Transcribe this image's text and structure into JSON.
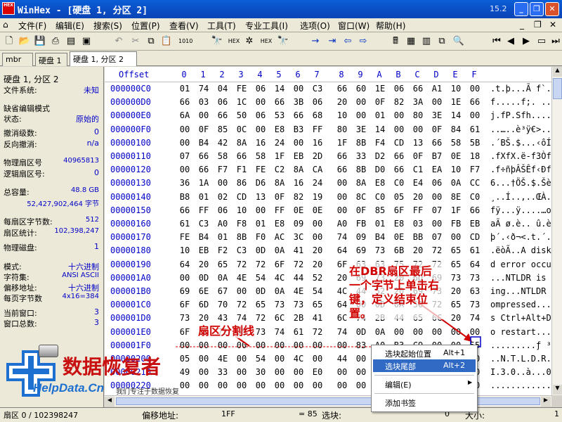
{
  "window": {
    "title": "WinHex - [硬盘 1, 分区 2]",
    "version": "15.2",
    "logo_text": "HEX"
  },
  "menu": [
    "文件(F)",
    "编辑(E)",
    "搜索(S)",
    "位置(P)",
    "查看(V)",
    "工具(T)",
    "专业工具(I)",
    "选项(O)",
    "窗口(W)",
    "帮助(H)"
  ],
  "tabs": [
    "mbr",
    "硬盘 1",
    "硬盘 1, 分区 2"
  ],
  "info": {
    "disk_name": "硬盘 1, 分区 2",
    "fs_label": "文件系统:",
    "fs_value": "未知",
    "mode_title": "缺省编辑模式",
    "state_label": "状态:",
    "state_value": "原始的",
    "undo_label": "撤消级数:",
    "undo_value": "0",
    "reverse_label": "反向撤消:",
    "reverse_value": "n/a",
    "phys_sector_label": "物理扇区号",
    "phys_sector_value": "40965813",
    "logic_sector_label": "逻辑扇区号:",
    "logic_sector_value": "0",
    "capacity_label": "总容量:",
    "capacity_gb": "48.8 GB",
    "capacity_bytes": "52,427,902,464 字节",
    "bps_label": "每扇区字节数:",
    "bps_value": "512",
    "sector_count_label": "扇区统计:",
    "sector_count_value": "102,398,247",
    "phys_disk_label": "物理磁盘:",
    "phys_disk_value": "1",
    "mode_label": "模式:",
    "mode_value": "十六进制",
    "charset_label": "字符集:",
    "charset_value": "ANSI ASCII",
    "offset_label": "偏移地址:",
    "offset_value": "十六进制",
    "bpp_label": "每页字节数",
    "bpp_value": "4x16=384",
    "cur_window_label": "当前窗口:",
    "cur_window_value": "3",
    "window_total_label": "窗口总数:",
    "window_total_value": "3"
  },
  "hex": {
    "header_offset": "Offset",
    "columns": [
      "0",
      "1",
      "2",
      "3",
      "4",
      "5",
      "6",
      "7",
      "8",
      "9",
      "A",
      "B",
      "C",
      "D",
      "E",
      "F"
    ],
    "rows": [
      {
        "off": "000000C0",
        "bytes": [
          "01",
          "74",
          "04",
          "FE",
          "06",
          "14",
          "00",
          "C3",
          "66",
          "60",
          "1E",
          "06",
          "66",
          "A1",
          "10",
          "00"
        ],
        "ascii": ".t.þ...Ã f`..f¡.."
      },
      {
        "off": "000000D0",
        "bytes": [
          "66",
          "03",
          "06",
          "1C",
          "00",
          "66",
          "3B",
          "06",
          "20",
          "00",
          "0F",
          "82",
          "3A",
          "00",
          "1E",
          "66"
        ],
        "ascii": "f.....f;. ..‚:..f"
      },
      {
        "off": "000000E0",
        "bytes": [
          "6A",
          "00",
          "66",
          "50",
          "06",
          "53",
          "66",
          "68",
          "10",
          "00",
          "01",
          "00",
          "80",
          "3E",
          "14",
          "00"
        ],
        "ascii": "j.fP.Sfh.....>.."
      },
      {
        "off": "000000F0",
        "bytes": [
          "00",
          "0F",
          "85",
          "0C",
          "00",
          "E8",
          "B3",
          "FF",
          "80",
          "3E",
          "14",
          "00",
          "00",
          "0F",
          "84",
          "61"
        ],
        "ascii": "..…..è³ÿ€>....„a"
      },
      {
        "off": "00000100",
        "bytes": [
          "00",
          "B4",
          "42",
          "8A",
          "16",
          "24",
          "00",
          "16",
          "1F",
          "8B",
          "F4",
          "CD",
          "13",
          "66",
          "58",
          "5B"
        ],
        "ascii": ".´BŠ.$...‹ôÍ.fX["
      },
      {
        "off": "00000110",
        "bytes": [
          "07",
          "66",
          "58",
          "66",
          "58",
          "1F",
          "EB",
          "2D",
          "66",
          "33",
          "D2",
          "66",
          "0F",
          "B7",
          "0E",
          "18"
        ],
        "ascii": ".fXfX.ë-f3Òf.·.."
      },
      {
        "off": "00000120",
        "bytes": [
          "00",
          "66",
          "F7",
          "F1",
          "FE",
          "C2",
          "8A",
          "CA",
          "66",
          "8B",
          "D0",
          "66",
          "C1",
          "EA",
          "10",
          "F7"
        ],
        "ascii": ".f÷ñþÂŠÊf‹ÐfÁê.÷"
      },
      {
        "off": "00000130",
        "bytes": [
          "36",
          "1A",
          "00",
          "86",
          "D6",
          "8A",
          "16",
          "24",
          "00",
          "8A",
          "E8",
          "C0",
          "E4",
          "06",
          "0A",
          "CC"
        ],
        "ascii": "6...†ÖŠ.$.ŠèÀä..Ì"
      },
      {
        "off": "00000140",
        "bytes": [
          "B8",
          "01",
          "02",
          "CD",
          "13",
          "0F",
          "82",
          "19",
          "00",
          "8C",
          "C0",
          "05",
          "20",
          "00",
          "8E",
          "C0"
        ],
        "ascii": "¸..Í..‚..ŒÀ. .ŽÀ"
      },
      {
        "off": "00000150",
        "bytes": [
          "66",
          "FF",
          "06",
          "10",
          "00",
          "FF",
          "0E",
          "0E",
          "00",
          "0F",
          "85",
          "6F",
          "FF",
          "07",
          "1F",
          "66"
        ],
        "ascii": "fÿ...ÿ....…oÿ..f"
      },
      {
        "off": "00000160",
        "bytes": [
          "61",
          "C3",
          "A0",
          "F8",
          "01",
          "E8",
          "09",
          "00",
          "A0",
          "FB",
          "01",
          "E8",
          "03",
          "00",
          "FB",
          "EB"
        ],
        "ascii": "aÃ ø.è.. û.è..ûë"
      },
      {
        "off": "00000170",
        "bytes": [
          "FE",
          "B4",
          "01",
          "8B",
          "F0",
          "AC",
          "3C",
          "00",
          "74",
          "09",
          "B4",
          "0E",
          "BB",
          "07",
          "00",
          "CD"
        ],
        "ascii": "þ´.‹ð¬<.t.´.»..Í"
      },
      {
        "off": "00000180",
        "bytes": [
          "10",
          "EB",
          "F2",
          "C3",
          "0D",
          "0A",
          "41",
          "20",
          "64",
          "69",
          "73",
          "6B",
          "20",
          "72",
          "65",
          "61"
        ],
        "ascii": ".ëòÃ..A disk rea"
      },
      {
        "off": "00000190",
        "bytes": [
          "64",
          "20",
          "65",
          "72",
          "72",
          "6F",
          "72",
          "20",
          "6F",
          "63",
          "63",
          "75",
          "72",
          "72",
          "65",
          "64"
        ],
        "ascii": "d error occurred"
      },
      {
        "off": "000001A0",
        "bytes": [
          "00",
          "0D",
          "0A",
          "4E",
          "54",
          "4C",
          "44",
          "52",
          "20",
          "69",
          "73",
          "20",
          "6D",
          "69",
          "73",
          "73"
        ],
        "ascii": "...NTLDR is miss"
      },
      {
        "off": "000001B0",
        "bytes": [
          "69",
          "6E",
          "67",
          "00",
          "0D",
          "0A",
          "4E",
          "54",
          "4C",
          "44",
          "52",
          "20",
          "69",
          "73",
          "20",
          "63"
        ],
        "ascii": "ing...NTLDR is c"
      },
      {
        "off": "000001C0",
        "bytes": [
          "6F",
          "6D",
          "70",
          "72",
          "65",
          "73",
          "73",
          "65",
          "64",
          "00",
          "0D",
          "0A",
          "50",
          "72",
          "65",
          "73"
        ],
        "ascii": "ompressed...Pres"
      },
      {
        "off": "000001D0",
        "bytes": [
          "73",
          "20",
          "43",
          "74",
          "72",
          "6C",
          "2B",
          "41",
          "6C",
          "74",
          "2B",
          "44",
          "65",
          "6C",
          "20",
          "74"
        ],
        "ascii": "s Ctrl+Alt+Del t"
      },
      {
        "off": "000001E0",
        "bytes": [
          "6F",
          "20",
          "72",
          "65",
          "73",
          "74",
          "61",
          "72",
          "74",
          "0D",
          "0A",
          "00",
          "00",
          "00",
          "00",
          "00"
        ],
        "ascii": "o restart......."
      },
      {
        "off": "000001F0",
        "bytes": [
          "00",
          "00",
          "00",
          "00",
          "00",
          "00",
          "00",
          "00",
          "00",
          "83",
          "A0",
          "B3",
          "C9",
          "00",
          "00",
          "55"
        ],
        "ascii": ".........ƒ ³É..U"
      },
      {
        "off": "00000200",
        "bytes": [
          "05",
          "00",
          "4E",
          "00",
          "54",
          "00",
          "4C",
          "00",
          "44",
          "00",
          "52",
          "00",
          "04",
          "00",
          "24",
          "00"
        ],
        "ascii": "..N.T.L.D.R...$."
      },
      {
        "off": "00000210",
        "bytes": [
          "49",
          "00",
          "33",
          "00",
          "30",
          "00",
          "00",
          "E0",
          "00",
          "00",
          "00",
          "30",
          "00",
          "00",
          "00",
          "00"
        ],
        "ascii": "I.3.0..à...0...."
      },
      {
        "off": "00000220",
        "bytes": [
          "00",
          "00",
          "00",
          "00",
          "00",
          "00",
          "00",
          "00",
          "00",
          "00",
          "00",
          "00",
          "00",
          "00",
          "00",
          "00"
        ],
        "ascii": "................"
      }
    ]
  },
  "annotations": {
    "dbr_note_lines": [
      "在DBR扇区最后",
      "一个字节上单击右",
      "键，定义结束位",
      "置。"
    ],
    "sector_divider": "扇区分割线"
  },
  "context_menu": [
    {
      "label": "选块起始位置",
      "accel": "Alt+1"
    },
    {
      "label": "选块尾部",
      "accel": "Alt+2"
    },
    {
      "label": "编辑(E)",
      "accel": ""
    },
    {
      "label": "添加书签",
      "accel": ""
    }
  ],
  "status": {
    "sector": "扇区 0 / 102398247",
    "offset_label": "偏移地址:",
    "offset_value": "1FF",
    "equals_value": "= 85",
    "block_label": "选块:",
    "size_label": "大小:",
    "size_value": "1",
    "mid_value": "0"
  },
  "brand": {
    "cn": "数据恢复者",
    "en": "HelpData.Cn",
    "tag": "我们专注于数据恢复"
  },
  "colors": {
    "accent_red": "#d00000",
    "hex_blue": "#0000c8",
    "menu_highlight": "#316ac5"
  }
}
